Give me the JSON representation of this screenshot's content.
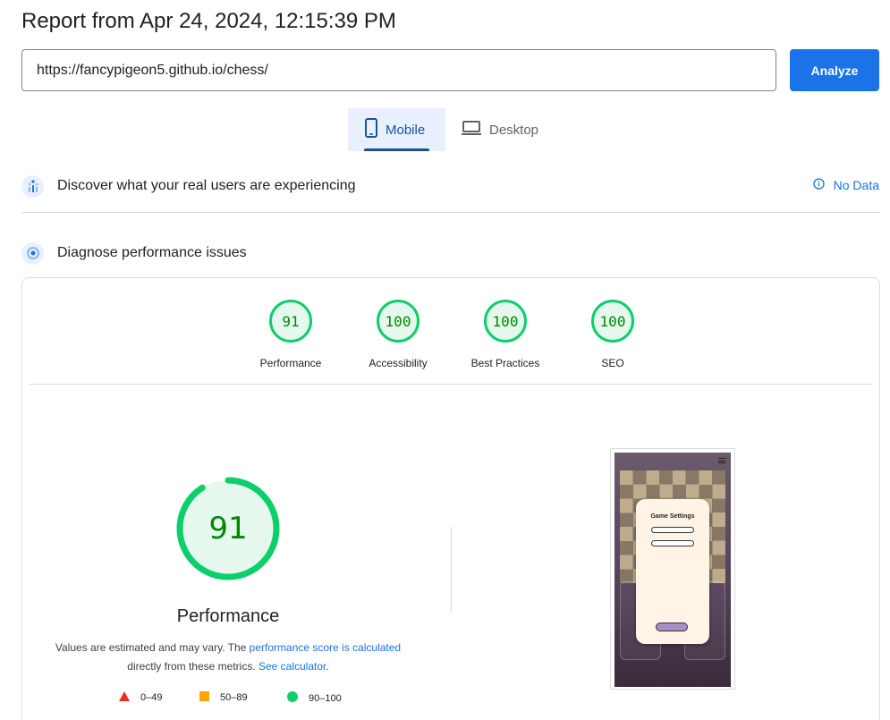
{
  "header": {
    "title": "Report from Apr 24, 2024, 12:15:39 PM"
  },
  "url_input": {
    "value": "https://fancypigeon5.github.io/chess/"
  },
  "analyze_button": {
    "label": "Analyze"
  },
  "tabs": [
    {
      "label": "Mobile",
      "icon": "phone-icon",
      "selected": true
    },
    {
      "label": "Desktop",
      "icon": "laptop-icon",
      "selected": false
    }
  ],
  "crux": {
    "title": "Discover what your real users are experiencing",
    "no_data": "No Data",
    "icon": "users-chart-icon"
  },
  "diagnose": {
    "title": "Diagnose performance issues",
    "icon": "target-icon"
  },
  "scores": [
    {
      "value": "91",
      "label": "Performance"
    },
    {
      "value": "100",
      "label": "Accessibility"
    },
    {
      "value": "100",
      "label": "Best Practices"
    },
    {
      "value": "100",
      "label": "SEO"
    }
  ],
  "performance": {
    "score": "91",
    "score_fraction": 0.91,
    "title": "Performance",
    "note_prefix": "Values are estimated and may vary. The ",
    "note_link": "performance score is calculated",
    "note_middle": "directly from these metrics. ",
    "note_link2": "See calculator",
    "note_suffix": "."
  },
  "legend": [
    {
      "range": "0–49",
      "color": "#e8331b",
      "shape": "triangle"
    },
    {
      "range": "50–89",
      "color": "#ffa400",
      "shape": "square"
    },
    {
      "range": "90–100",
      "color": "#0cce6b",
      "shape": "circle"
    }
  ],
  "screenshot": {
    "modal_title": "Game Settings"
  },
  "colors": {
    "accent": "#1a73e8",
    "pass": "#0cce6b",
    "pass_text": "#008800"
  }
}
